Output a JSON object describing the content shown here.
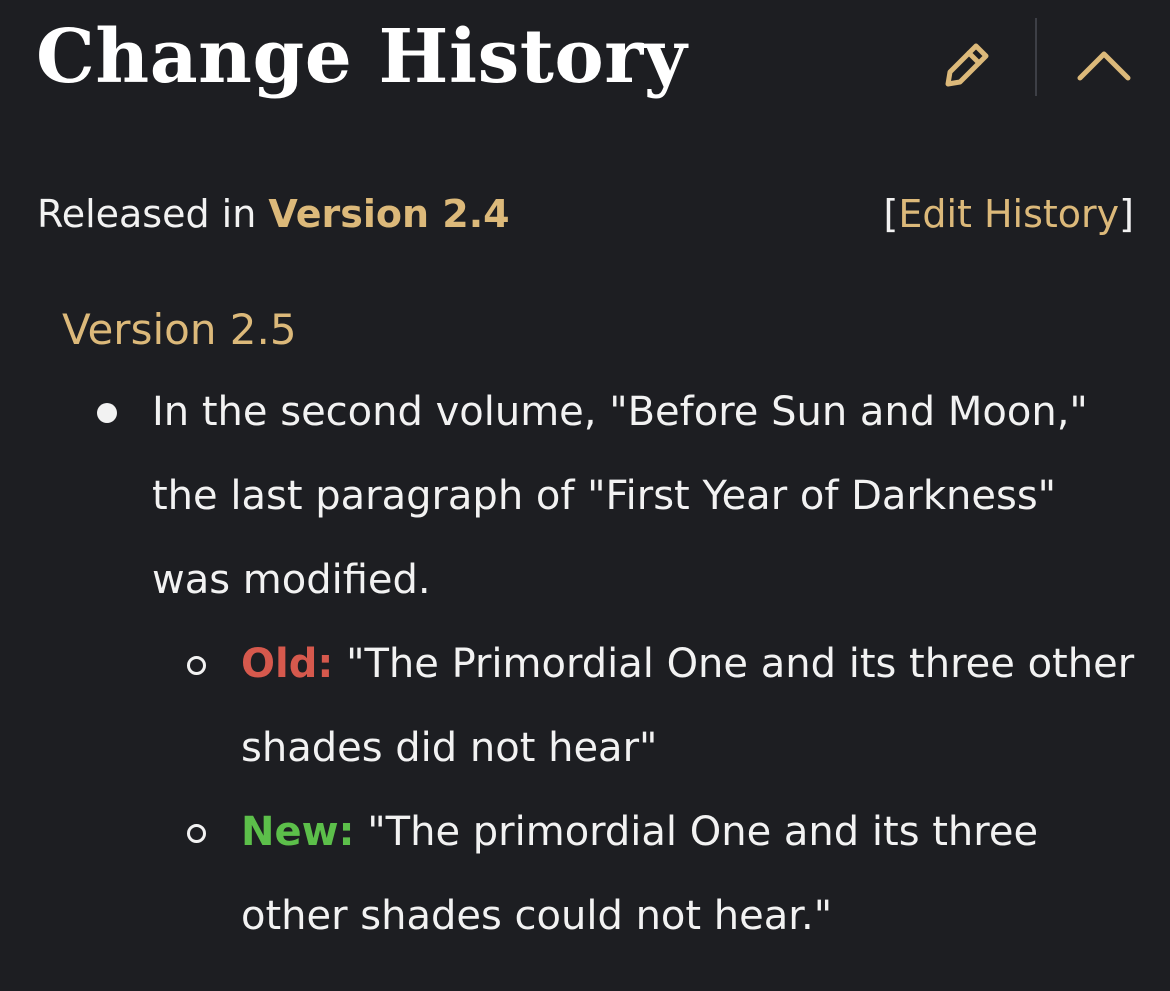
{
  "header": {
    "title": "Change History",
    "edit_icon": "pencil-icon",
    "collapse_icon": "chevron-up-icon"
  },
  "release": {
    "prefix": "Released in",
    "version": "Version 2.4",
    "edit_history_open": "[",
    "edit_history_label": "Edit History",
    "edit_history_close": "]"
  },
  "changes": {
    "version_heading": "Version 2.5",
    "main_text": "In the second volume, \"Before Sun and Moon,\" the last paragraph of \"First Year of Darkness\" was modified.",
    "old_label": "Old:",
    "old_text": "\"The Primordial One and its three other shades did not hear\"",
    "new_label": "New:",
    "new_text": "\"The primordial One and its three other shades could not hear.\""
  },
  "colors": {
    "background": "#1d1e22",
    "accent_gold": "#dcb97a",
    "old_red": "#d6594d",
    "new_green": "#5cbf4a",
    "text": "#f2f2f2"
  }
}
